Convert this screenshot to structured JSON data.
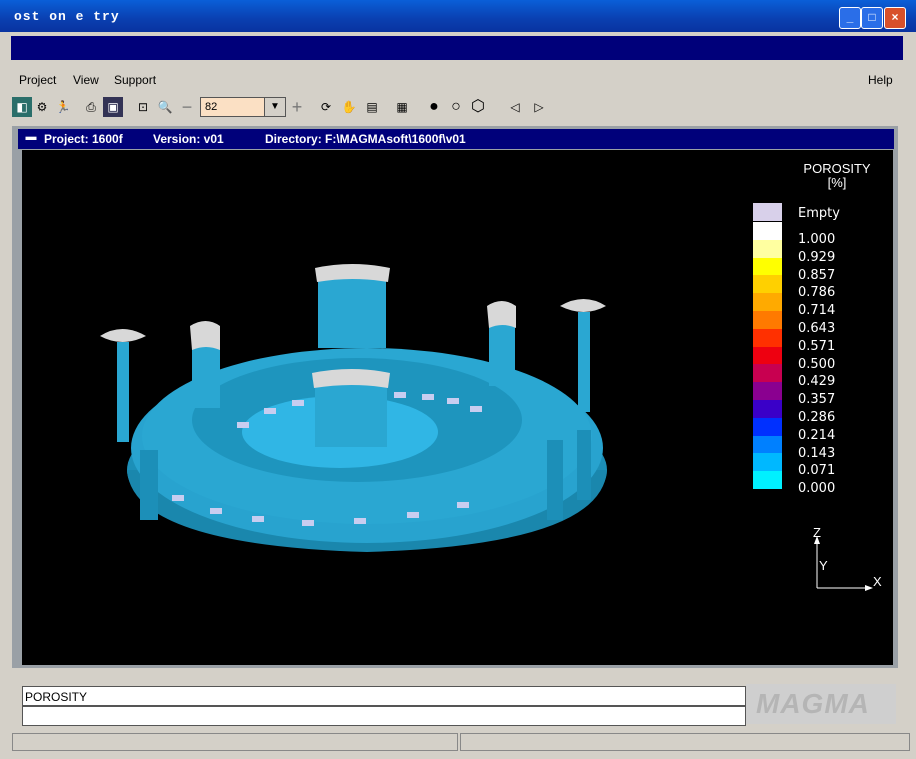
{
  "window": {
    "title": "ost on e try",
    "min_icon": "minimize-icon",
    "max_icon": "maximize-icon",
    "close_icon": "close-icon"
  },
  "menu": {
    "project": "Project",
    "view": "View",
    "support": "Support",
    "help": "Help"
  },
  "toolbar": {
    "zoom_value": "82",
    "icons": [
      "exit-icon",
      "settings-icon",
      "run-icon",
      "print-icon",
      "export-image-icon",
      "zoom-fit-icon",
      "zoom-in-icon",
      "zoom-out-icon",
      "zoom-plus-icon",
      "rotate-icon",
      "pan-hand-icon",
      "cylinder-view-icon",
      "layers-icon",
      "solid-sphere-icon",
      "outline-sphere-icon",
      "hexagon-icon",
      "previous-icon",
      "next-icon"
    ]
  },
  "panel": {
    "project": "Project: 1600f",
    "version": "Version: v01",
    "directory": "Directory: F:\\MAGMAsoft\\1600f\\v01"
  },
  "legend": {
    "title_line1": "POROSITY",
    "title_line2": "[%]",
    "empty_label": "Empty",
    "entries": [
      {
        "label": "1.000",
        "color": "#ffffff"
      },
      {
        "label": "0.929",
        "color": "#ffffa0"
      },
      {
        "label": "0.857",
        "color": "#ffff00"
      },
      {
        "label": "0.786",
        "color": "#ffd000"
      },
      {
        "label": "0.714",
        "color": "#ffaa00"
      },
      {
        "label": "0.643",
        "color": "#ff7a00"
      },
      {
        "label": "0.571",
        "color": "#ff3000"
      },
      {
        "label": "0.500",
        "color": "#ee0010"
      },
      {
        "label": "0.429",
        "color": "#c80050"
      },
      {
        "label": "0.357",
        "color": "#8a0090"
      },
      {
        "label": "0.286",
        "color": "#3a00c8"
      },
      {
        "label": "0.214",
        "color": "#0030ff"
      },
      {
        "label": "0.143",
        "color": "#0080ff"
      },
      {
        "label": "0.071",
        "color": "#00b8ff"
      },
      {
        "label": "0.000",
        "color": "#00f0ff"
      }
    ],
    "empty_color": "#d8d0ea"
  },
  "axes": {
    "z": "Z",
    "y": "Y",
    "x": "X"
  },
  "status": {
    "line1": "POROSITY",
    "line2": ""
  },
  "logo": "MAGMA"
}
